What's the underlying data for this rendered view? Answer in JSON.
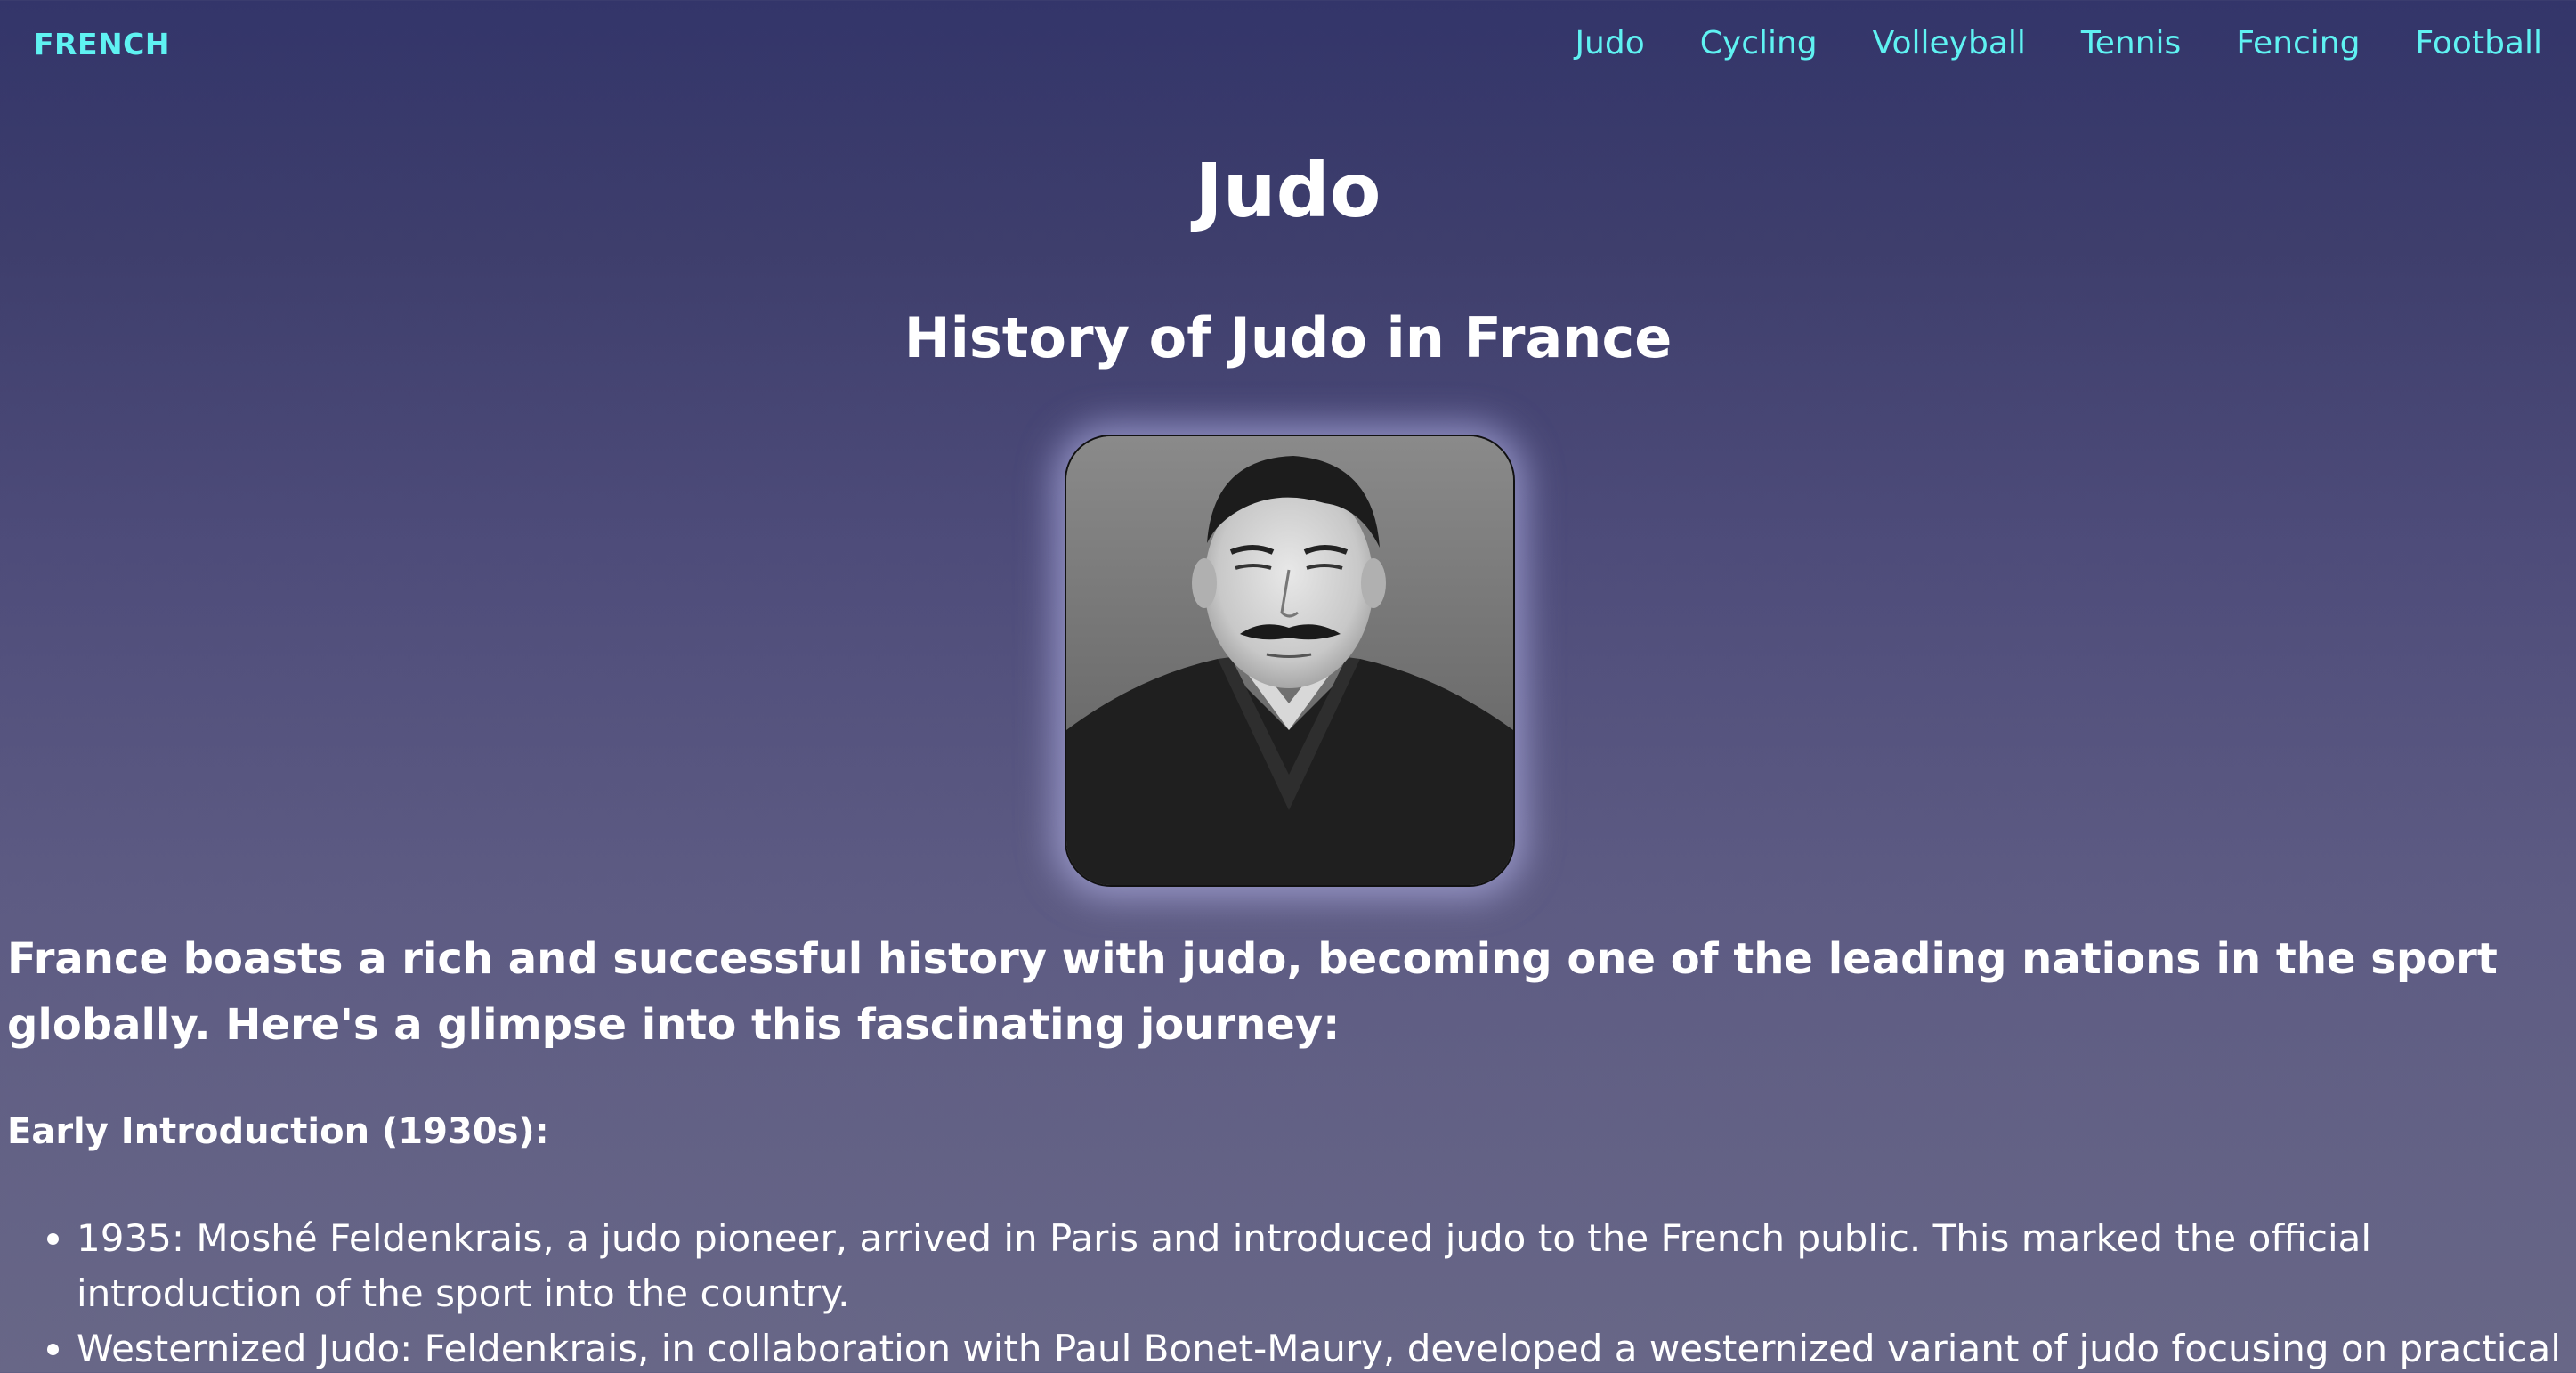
{
  "nav": {
    "brand": "FRENCH",
    "links": [
      "Judo",
      "Cycling",
      "Volleyball",
      "Tennis",
      "Fencing",
      "Football"
    ]
  },
  "page": {
    "title": "Judo",
    "section_title": "History of Judo in France",
    "intro": "France boasts a rich and successful history with judo, becoming one of the leading nations in the sport globally. Here's a glimpse into this fascinating journey:",
    "subhead": "Early Introduction (1930s):",
    "bullets": [
      "1935: Moshé Feldenkrais, a judo pioneer, arrived in Paris and introduced judo to the French public. This marked the official introduction of the sport into the country.",
      "Westernized Judo: Feldenkrais, in collaboration with Paul Bonet-Maury, developed a westernized variant of judo focusing on practical"
    ]
  },
  "colors": {
    "accent": "#5ff2f2",
    "text": "#ffffff",
    "bg_top": "#33356a",
    "bg_bottom": "#686787"
  }
}
